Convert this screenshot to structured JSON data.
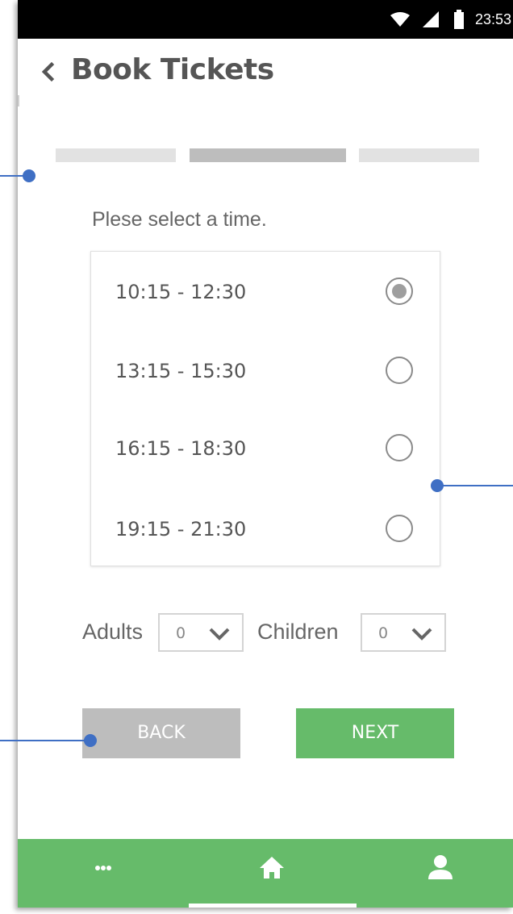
{
  "status_bar": {
    "time": "23:53"
  },
  "header": {
    "title": "Book Tickets"
  },
  "steps": {
    "total": 3,
    "current": 2
  },
  "prompt": "Plese select a time.",
  "times": [
    {
      "label": "10:15 - 12:30",
      "selected": true
    },
    {
      "label": "13:15 - 15:30",
      "selected": false
    },
    {
      "label": "16:15 - 18:30",
      "selected": false
    },
    {
      "label": "19:15 - 21:30",
      "selected": false
    }
  ],
  "tickets": {
    "adults_label": "Adults",
    "adults_value": "0",
    "children_label": "Children",
    "children_value": "0"
  },
  "buttons": {
    "back": "BACK",
    "next": "NEXT"
  },
  "bottom_nav": {
    "items": [
      "more-icon",
      "home-icon",
      "profile-icon"
    ],
    "active": "home-icon"
  },
  "colors": {
    "accent": "#66bb6a",
    "disabled": "#bdbdbd",
    "annotation": "#3f6fc4"
  }
}
